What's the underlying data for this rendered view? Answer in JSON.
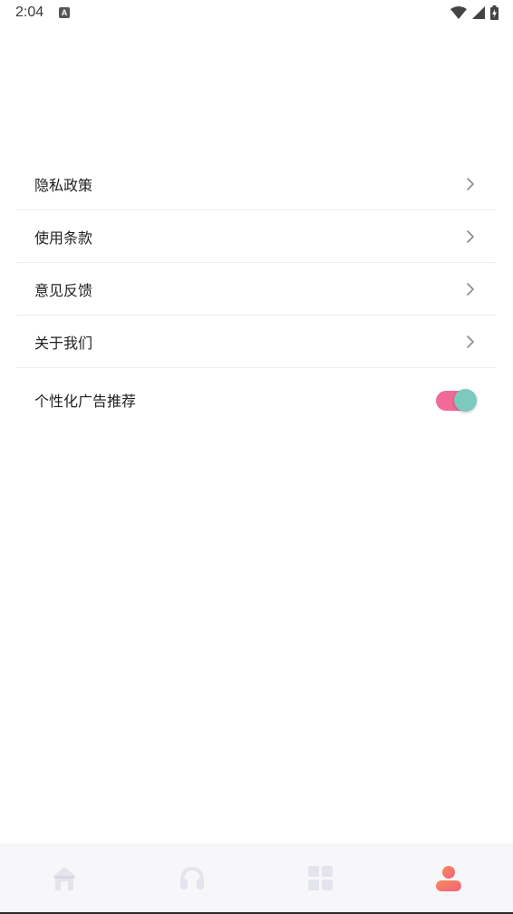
{
  "status_bar": {
    "time": "2:04",
    "icons": [
      "notification-a-icon",
      "wifi-icon",
      "signal-icon",
      "battery-charging-icon"
    ]
  },
  "settings": {
    "items": [
      {
        "label": "隐私政策",
        "icon": "chevron-right-icon"
      },
      {
        "label": "使用条款",
        "icon": "chevron-right-icon"
      },
      {
        "label": "意见反馈",
        "icon": "chevron-right-icon"
      },
      {
        "label": "关于我们",
        "icon": "chevron-right-icon"
      }
    ],
    "ad_toggle": {
      "label": "个性化广告推荐",
      "enabled": true
    }
  },
  "bottom_nav": {
    "items": [
      {
        "icon": "home-icon",
        "active": false
      },
      {
        "icon": "headphones-icon",
        "active": false
      },
      {
        "icon": "grid-icon",
        "active": false
      },
      {
        "icon": "profile-icon",
        "active": true
      }
    ]
  },
  "colors": {
    "toggle_track": "#f26a97",
    "toggle_knob": "#7cc9bd",
    "nav_inactive": "#e4e4ec",
    "nav_active": "#f47e6a"
  }
}
